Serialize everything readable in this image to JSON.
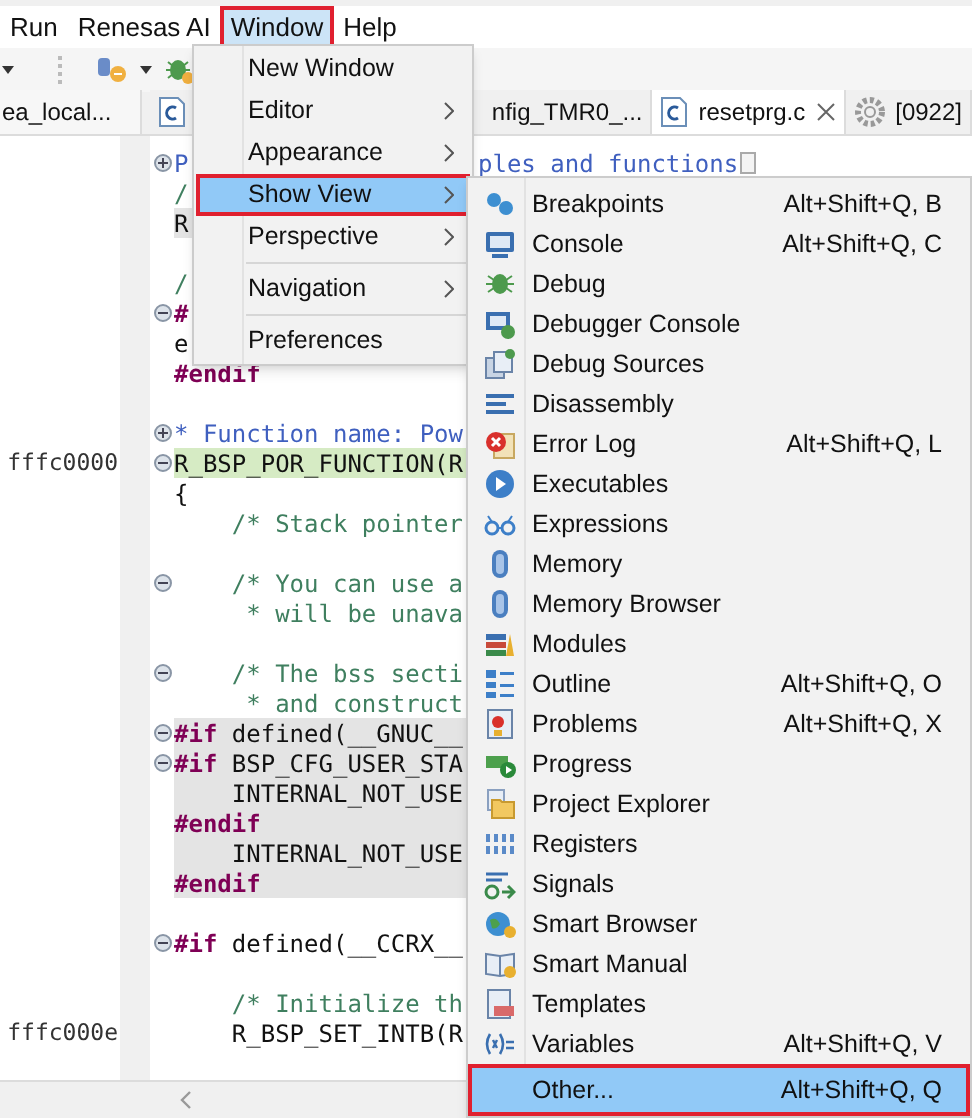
{
  "menubar": [
    {
      "label": "Run",
      "selected": false,
      "outlined": false
    },
    {
      "label": "Renesas AI",
      "selected": false,
      "outlined": false
    },
    {
      "label": "Window",
      "selected": true,
      "outlined": true
    },
    {
      "label": "Help",
      "selected": false,
      "outlined": false
    }
  ],
  "side_tab": {
    "label": "ea_local..."
  },
  "editor_tabs": [
    {
      "label": "nfig_TMR0_...",
      "kind": "source",
      "selected": false,
      "closable": false
    },
    {
      "label": "resetprg.c",
      "kind": "source",
      "selected": true,
      "closable": true
    },
    {
      "label": "[0922]",
      "kind": "config",
      "selected": false,
      "closable": false
    }
  ],
  "code_lines": [
    {
      "kind": "code",
      "expanded": false,
      "inactive": false,
      "current": false,
      "segments": [
        {
          "kind": "doc",
          "text": "P"
        }
      ],
      "tail": [
        {
          "kind": "doc",
          "text": "ples and functions"
        }
      ],
      "folded": true
    },
    {
      "kind": "code",
      "inactive": false,
      "current": false,
      "segments": [
        {
          "kind": "comment",
          "text": "/"
        }
      ]
    },
    {
      "kind": "code",
      "inactive": true,
      "current": false,
      "segments": [
        {
          "kind": "plain",
          "text": "R"
        }
      ]
    },
    {
      "kind": "blank"
    },
    {
      "kind": "code",
      "inactive": false,
      "current": false,
      "segments": [
        {
          "kind": "comment",
          "text": "/"
        }
      ]
    },
    {
      "kind": "code",
      "expanded": true,
      "inactive": false,
      "current": false,
      "segments": [
        {
          "kind": "directive",
          "text": "#"
        }
      ]
    },
    {
      "kind": "code",
      "inactive": false,
      "current": false,
      "segments": [
        {
          "kind": "plain",
          "text": "e"
        }
      ]
    },
    {
      "kind": "code",
      "inactive": false,
      "current": false,
      "segments": [
        {
          "kind": "directive",
          "text": "#endif"
        }
      ]
    },
    {
      "kind": "blank"
    },
    {
      "kind": "code",
      "expanded": false,
      "inactive": false,
      "current": false,
      "segments": [
        {
          "kind": "doc",
          "text": "* Function name: Pow"
        }
      ]
    },
    {
      "kind": "code",
      "expanded": true,
      "inactive": false,
      "current": true,
      "address": "fffc0000",
      "segments": [
        {
          "kind": "plain",
          "text": "R_BSP_POR_FUNCTION(R"
        }
      ]
    },
    {
      "kind": "code",
      "inactive": false,
      "current": false,
      "segments": [
        {
          "kind": "plain",
          "text": "{"
        }
      ]
    },
    {
      "kind": "code",
      "inactive": false,
      "current": false,
      "segments": [
        {
          "kind": "comment",
          "text": "    /* Stack pointer"
        }
      ]
    },
    {
      "kind": "blank"
    },
    {
      "kind": "code",
      "expanded": true,
      "inactive": false,
      "current": false,
      "segments": [
        {
          "kind": "comment",
          "text": "    /* You can use a"
        }
      ]
    },
    {
      "kind": "code",
      "inactive": false,
      "current": false,
      "segments": [
        {
          "kind": "comment",
          "text": "     * will be unava"
        }
      ]
    },
    {
      "kind": "blank"
    },
    {
      "kind": "code",
      "expanded": true,
      "inactive": false,
      "current": false,
      "segments": [
        {
          "kind": "comment",
          "text": "    /* The bss secti"
        }
      ]
    },
    {
      "kind": "code",
      "inactive": false,
      "current": false,
      "segments": [
        {
          "kind": "comment",
          "text": "     * and construct"
        }
      ]
    },
    {
      "kind": "code",
      "expanded": true,
      "inactive": true,
      "current": false,
      "segments": [
        {
          "kind": "directive",
          "text": "#if"
        },
        {
          "kind": "plain",
          "text": " defined(__GNUC__"
        }
      ]
    },
    {
      "kind": "code",
      "expanded": true,
      "inactive": true,
      "current": false,
      "segments": [
        {
          "kind": "directive",
          "text": "#if"
        },
        {
          "kind": "plain",
          "text": " BSP_CFG_USER_STA"
        }
      ]
    },
    {
      "kind": "code",
      "inactive": true,
      "current": false,
      "segments": [
        {
          "kind": "plain",
          "text": "    INTERNAL_NOT_USE"
        }
      ]
    },
    {
      "kind": "code",
      "inactive": true,
      "current": false,
      "segments": [
        {
          "kind": "directive",
          "text": "#endif"
        }
      ]
    },
    {
      "kind": "code",
      "inactive": true,
      "current": false,
      "segments": [
        {
          "kind": "plain",
          "text": "    INTERNAL_NOT_USE"
        }
      ]
    },
    {
      "kind": "code",
      "inactive": true,
      "current": false,
      "segments": [
        {
          "kind": "directive",
          "text": "#endif"
        }
      ]
    },
    {
      "kind": "blank"
    },
    {
      "kind": "code",
      "expanded": true,
      "inactive": false,
      "current": false,
      "segments": [
        {
          "kind": "directive",
          "text": "#if"
        },
        {
          "kind": "plain",
          "text": " defined(__CCRX__"
        }
      ]
    },
    {
      "kind": "blank"
    },
    {
      "kind": "code",
      "inactive": false,
      "current": false,
      "segments": [
        {
          "kind": "comment",
          "text": "    /* Initialize th"
        }
      ]
    },
    {
      "kind": "code",
      "inactive": false,
      "current": false,
      "address": "fffc000e",
      "segments": [
        {
          "kind": "plain",
          "text": "    R_BSP_SET_INTB(R"
        }
      ]
    }
  ],
  "window_menu": [
    {
      "kind": "item",
      "label": "New Window",
      "submenu": false,
      "selected": false,
      "outlined": false
    },
    {
      "kind": "item",
      "label": "Editor",
      "submenu": true,
      "selected": false,
      "outlined": false
    },
    {
      "kind": "item",
      "label": "Appearance",
      "submenu": true,
      "selected": false,
      "outlined": false
    },
    {
      "kind": "item",
      "label": "Show View",
      "submenu": true,
      "selected": true,
      "outlined": true
    },
    {
      "kind": "item",
      "label": "Perspective",
      "submenu": true,
      "selected": false,
      "outlined": false
    },
    {
      "kind": "separator"
    },
    {
      "kind": "item",
      "label": "Navigation",
      "submenu": true,
      "selected": false,
      "outlined": false
    },
    {
      "kind": "separator"
    },
    {
      "kind": "item",
      "label": "Preferences",
      "submenu": false,
      "selected": false,
      "outlined": false
    }
  ],
  "show_view_menu": [
    {
      "label": "Breakpoints",
      "shortcut": "Alt+Shift+Q, B",
      "selected": false,
      "outlined": false
    },
    {
      "label": "Console",
      "shortcut": "Alt+Shift+Q, C",
      "selected": false,
      "outlined": false
    },
    {
      "label": "Debug",
      "selected": false,
      "outlined": false
    },
    {
      "label": "Debugger Console",
      "selected": false,
      "outlined": false
    },
    {
      "label": "Debug Sources",
      "selected": false,
      "outlined": false
    },
    {
      "label": "Disassembly",
      "selected": false,
      "outlined": false
    },
    {
      "label": "Error Log",
      "shortcut": "Alt+Shift+Q, L",
      "selected": false,
      "outlined": false
    },
    {
      "label": "Executables",
      "selected": false,
      "outlined": false
    },
    {
      "label": "Expressions",
      "selected": false,
      "outlined": false
    },
    {
      "label": "Memory",
      "selected": false,
      "outlined": false
    },
    {
      "label": "Memory Browser",
      "selected": false,
      "outlined": false
    },
    {
      "label": "Modules",
      "selected": false,
      "outlined": false
    },
    {
      "label": "Outline",
      "shortcut": "Alt+Shift+Q, O",
      "selected": false,
      "outlined": false
    },
    {
      "label": "Problems",
      "shortcut": "Alt+Shift+Q, X",
      "selected": false,
      "outlined": false
    },
    {
      "label": "Progress",
      "selected": false,
      "outlined": false
    },
    {
      "label": "Project Explorer",
      "selected": false,
      "outlined": false
    },
    {
      "label": "Registers",
      "selected": false,
      "outlined": false
    },
    {
      "label": "Signals",
      "selected": false,
      "outlined": false
    },
    {
      "label": "Smart Browser",
      "selected": false,
      "outlined": false
    },
    {
      "label": "Smart Manual",
      "selected": false,
      "outlined": false
    },
    {
      "label": "Templates",
      "selected": false,
      "outlined": false
    },
    {
      "label": "Variables",
      "shortcut": "Alt+Shift+Q, V",
      "selected": false,
      "outlined": false
    },
    {
      "label": "Other...",
      "shortcut": "Alt+Shift+Q, Q",
      "selected": true,
      "outlined": true
    }
  ]
}
